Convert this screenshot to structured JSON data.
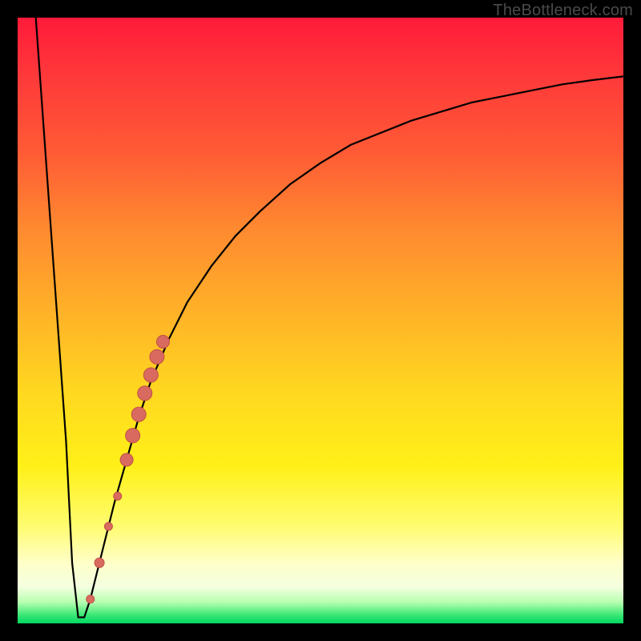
{
  "watermark": "TheBottleneck.com",
  "colors": {
    "curve": "#000000",
    "dot_fill": "#d86a60",
    "dot_stroke": "#c24f46",
    "frame": "#000000"
  },
  "chart_data": {
    "type": "line",
    "title": "",
    "xlabel": "",
    "ylabel": "",
    "xlim": [
      0,
      100
    ],
    "ylim": [
      0,
      100
    ],
    "grid": false,
    "legend": null,
    "series": [
      {
        "name": "bottleneck-curve",
        "note": "y is bottleneck fraction, 0 = optimal (bottom), 100 = worst (top). Curve drops from 100 at x≈3 to 0 near x≈9, floors briefly, then rises asymptotically toward ~92.",
        "x": [
          3,
          4,
          5,
          6,
          7,
          8,
          9,
          10,
          11,
          12,
          14,
          16,
          18,
          20,
          22,
          25,
          28,
          32,
          36,
          40,
          45,
          50,
          55,
          60,
          65,
          70,
          75,
          80,
          85,
          90,
          95,
          100
        ],
        "y": [
          100,
          86,
          72,
          58,
          44,
          30,
          10,
          1,
          1,
          4,
          12,
          20,
          27,
          34,
          40,
          47,
          53,
          59,
          64,
          68,
          72.5,
          76,
          79,
          81,
          83,
          84.5,
          86,
          87,
          88,
          89,
          89.7,
          90.3
        ]
      }
    ],
    "markers": {
      "name": "highlighted-points",
      "note": "salmon dots lying on the rising branch, lower-left cluster",
      "points": [
        {
          "x": 12.0,
          "y": 4.0,
          "r": 5
        },
        {
          "x": 13.5,
          "y": 10.0,
          "r": 6
        },
        {
          "x": 15.0,
          "y": 16.0,
          "r": 5
        },
        {
          "x": 16.5,
          "y": 21.0,
          "r": 5
        },
        {
          "x": 18.0,
          "y": 27.0,
          "r": 8
        },
        {
          "x": 19.0,
          "y": 31.0,
          "r": 9
        },
        {
          "x": 20.0,
          "y": 34.5,
          "r": 9
        },
        {
          "x": 21.0,
          "y": 38.0,
          "r": 9
        },
        {
          "x": 22.0,
          "y": 41.0,
          "r": 9
        },
        {
          "x": 23.0,
          "y": 44.0,
          "r": 9
        },
        {
          "x": 24.0,
          "y": 46.5,
          "r": 8
        }
      ]
    }
  }
}
